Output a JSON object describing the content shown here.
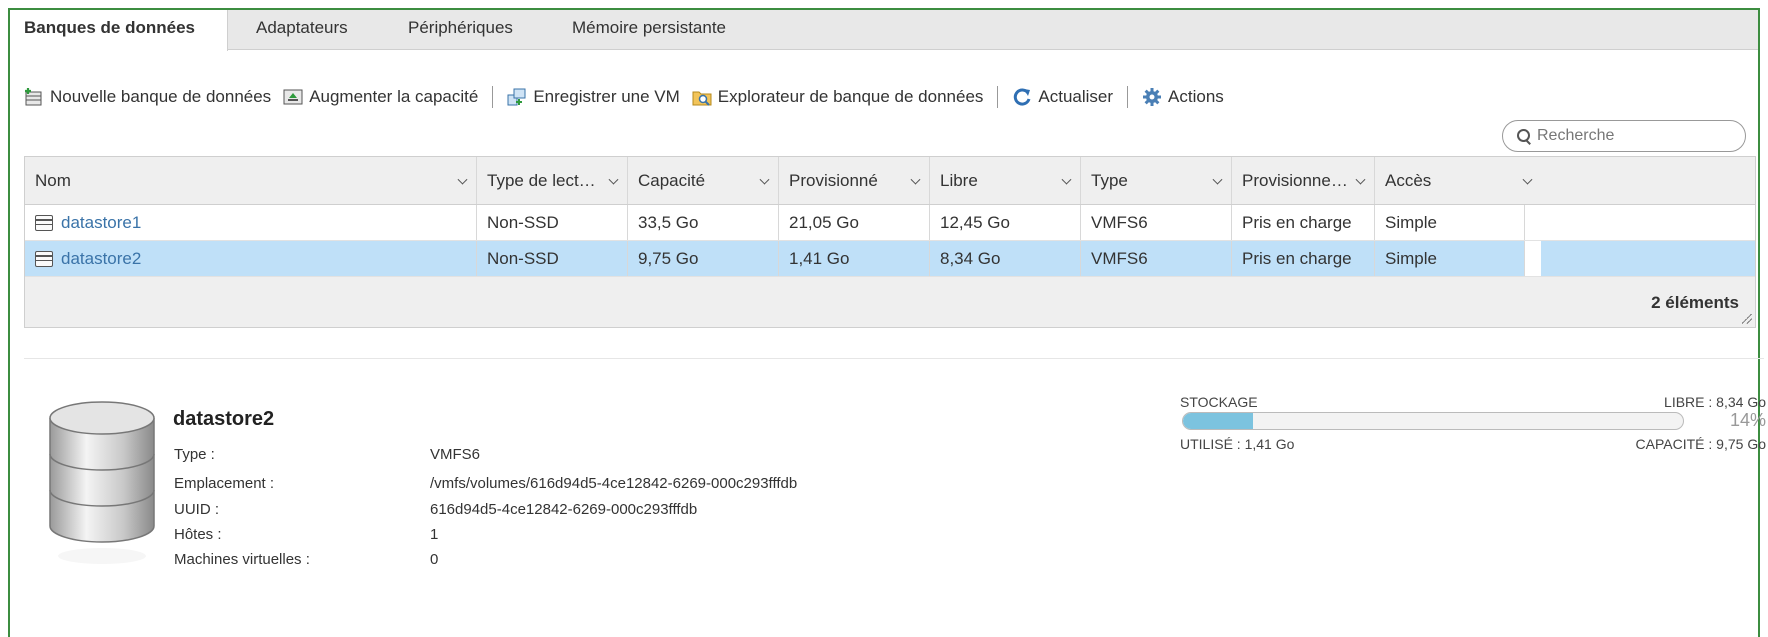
{
  "tabs": [
    {
      "label": "Banques de données",
      "active": true
    },
    {
      "label": "Adaptateurs",
      "active": false
    },
    {
      "label": "Périphériques",
      "active": false
    },
    {
      "label": "Mémoire persistante",
      "active": false
    }
  ],
  "toolbar": {
    "new_datastore": "Nouvelle banque de données",
    "increase_capacity": "Augmenter la capacité",
    "register_vm": "Enregistrer une VM",
    "datastore_browser": "Explorateur de banque de données",
    "refresh": "Actualiser",
    "actions": "Actions"
  },
  "search": {
    "placeholder": "Recherche"
  },
  "grid": {
    "columns": [
      "Nom",
      "Type de lect…",
      "Capacité",
      "Provisionné",
      "Libre",
      "Type",
      "Provisionne…",
      "Accès"
    ],
    "rows": [
      {
        "name": "datastore1",
        "drive": "Non-SSD",
        "capacity": "33,5 Go",
        "provisioned": "21,05 Go",
        "free": "12,45 Go",
        "type": "VMFS6",
        "thin": "Pris en charge",
        "access": "Simple",
        "selected": false
      },
      {
        "name": "datastore2",
        "drive": "Non-SSD",
        "capacity": "9,75 Go",
        "provisioned": "1,41 Go",
        "free": "8,34 Go",
        "type": "VMFS6",
        "thin": "Pris en charge",
        "access": "Simple",
        "selected": true
      }
    ],
    "footer_count": "2 éléments"
  },
  "details": {
    "title": "datastore2",
    "props": [
      {
        "key": "Type :",
        "value": "VMFS6"
      },
      {
        "key": "Emplacement :",
        "value": "/vmfs/volumes/616d94d5-4ce12842-6269-000c293fffdb"
      },
      {
        "key": "UUID :",
        "value": "616d94d5-4ce12842-6269-000c293fffdb"
      },
      {
        "key": "Hôtes :",
        "value": "1"
      },
      {
        "key": "Machines virtuelles :",
        "value": "0"
      }
    ]
  },
  "storage": {
    "label": "STOCKAGE",
    "free": "LIBRE : 8,34 Go",
    "percent": "14%",
    "used_fraction": 0.14,
    "used": "UTILISÉ : 1,41 Go",
    "capacity": "CAPACITÉ : 9,75 Go",
    "bar_color": "#7cc3df"
  },
  "colors": {
    "accent_border": "#3c8d40",
    "selected_row": "#bfe0f8",
    "link": "#3a73a8"
  }
}
